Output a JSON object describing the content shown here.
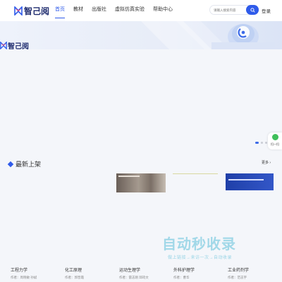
{
  "brand": {
    "name": "智己阅",
    "primary_color": "#2f5bea",
    "logo_color": "#1e2b6e"
  },
  "nav": {
    "items": [
      {
        "label": "首页",
        "active": true
      },
      {
        "label": "教材",
        "active": false
      },
      {
        "label": "出版社",
        "active": false
      },
      {
        "label": "虚拟仿真实验",
        "active": false
      },
      {
        "label": "帮助中心",
        "active": false
      }
    ]
  },
  "search": {
    "placeholder": "请输入搜索内容",
    "icon": "search-icon"
  },
  "login_label": "登录",
  "carousel": {
    "slides": 3,
    "active_index": 0
  },
  "float_widget": {
    "label": "扫一扫",
    "icon": "leaf-icon"
  },
  "new_section": {
    "title": "最新上架",
    "more_label": "更多 ›"
  },
  "watermark": {
    "main": "自动秒收录",
    "sub": "做上链接→来访一次→自动收录"
  },
  "books": [
    {
      "title": "工程力学",
      "author": "作者：周晓敏 孙斌"
    },
    {
      "title": "化工原理",
      "author": "作者：郭晋霞"
    },
    {
      "title": "运动生理学",
      "author": "作者：雷志刚 邱筠文"
    },
    {
      "title": "外科护理学",
      "author": "作者：曹华"
    },
    {
      "title": "工业药剂学",
      "author": "作者：范志宇"
    }
  ]
}
